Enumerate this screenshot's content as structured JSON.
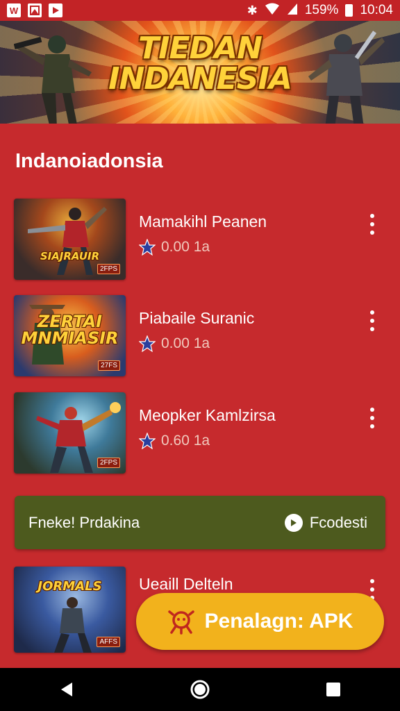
{
  "status_bar": {
    "left_icons": [
      "W",
      "image",
      "play"
    ],
    "bluetooth": "✱",
    "battery_text": "159%",
    "time": "10:04"
  },
  "banner": {
    "title_line1": "TIEDAN",
    "title_line2": "INDANESIA"
  },
  "section_title": "Indanоiadonsia",
  "items": [
    {
      "title": "Mamakihl Peanen",
      "rating": "0.00 1a",
      "thumb_text": "SIAJRAUIR",
      "thumb_badge": "2FPS"
    },
    {
      "title": "Piabaile Suranic",
      "rating": "0.00 1a",
      "thumb_text": "ZERTAI MNMIASIR",
      "thumb_badge": "27FS"
    },
    {
      "title": "Meopker Kamlzirsa",
      "rating": "0.60 1a",
      "thumb_text": "",
      "thumb_badge": "2FPS"
    },
    {
      "title": "Ueaill Delteln",
      "rating": "",
      "thumb_text": "JORMALS",
      "thumb_badge": "AFFS"
    }
  ],
  "promo": {
    "left_text": "Fneke! Prdakina",
    "right_text": "Fcodesti"
  },
  "fab": {
    "label": "Penalagn: APK"
  },
  "colors": {
    "background": "#c62a2d",
    "promo": "#4d5a1e",
    "fab": "#f2b21c"
  }
}
